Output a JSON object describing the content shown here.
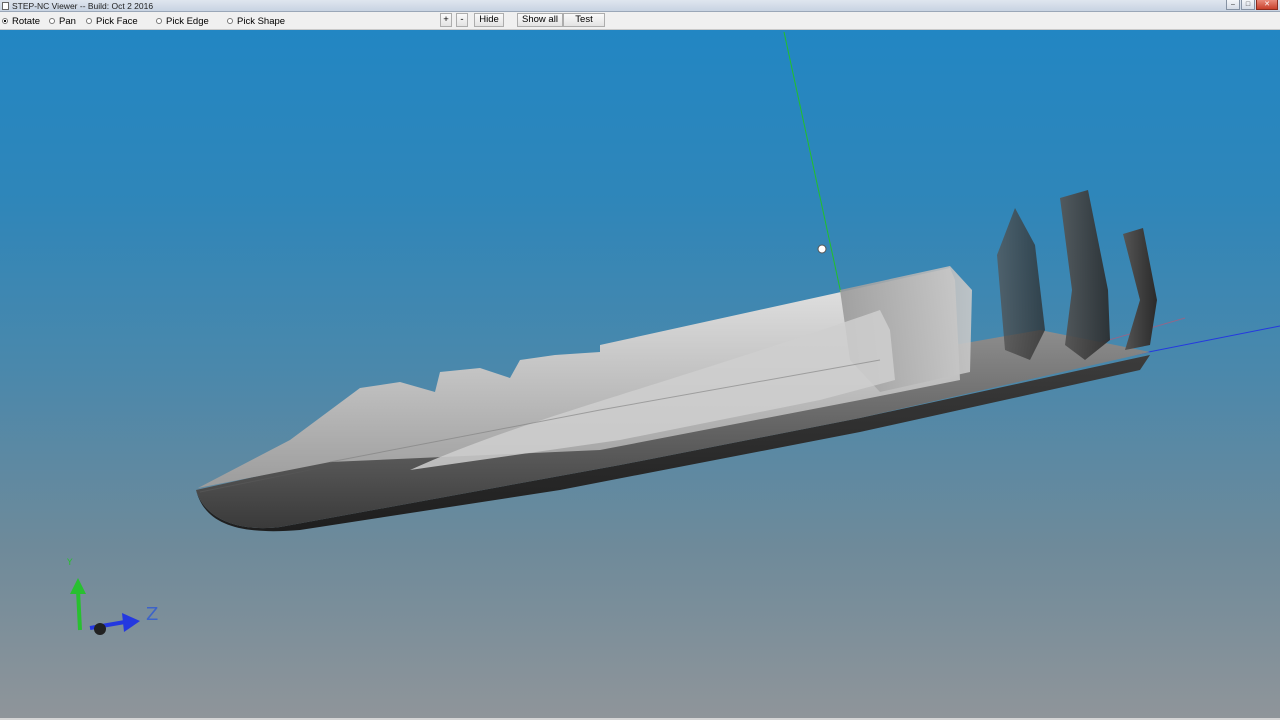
{
  "window": {
    "title": "STEP-NC Viewer -- Build: Oct  2 2016",
    "minimize": "–",
    "maximize": "□",
    "close": "✕"
  },
  "toolbar": {
    "modes": [
      {
        "label": "Rotate",
        "checked": true
      },
      {
        "label": "Pan",
        "checked": false
      },
      {
        "label": "Pick Face",
        "checked": false
      },
      {
        "label": "Pick Edge",
        "checked": false
      },
      {
        "label": "Pick Shape",
        "checked": false
      }
    ],
    "zoom_in": "+",
    "zoom_out": "-",
    "hide": "Hide",
    "show_all": "Show all",
    "test": "Test"
  },
  "viewport": {
    "axis_triad": {
      "z_label": "Z",
      "y_label": "Y"
    },
    "colors": {
      "y_axis": "#22c02a",
      "z_axis": "#2438e0",
      "model_light": "#d9d9d9",
      "model_dark": "#2b2b2b"
    }
  }
}
